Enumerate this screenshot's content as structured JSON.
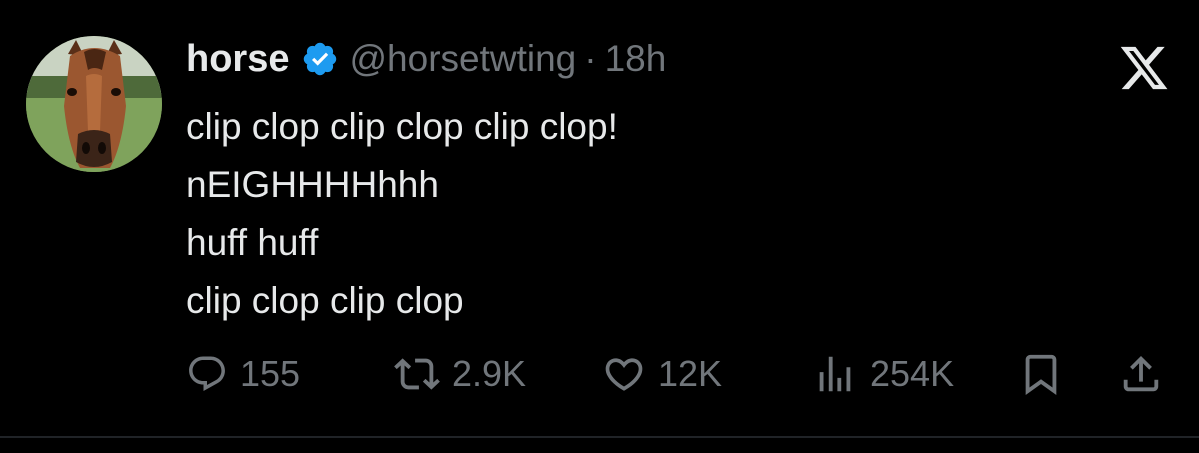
{
  "author": {
    "name": "horse",
    "handle": "@horsetwting",
    "separator": "·",
    "time": "18h",
    "verified": true,
    "avatar_icon": "horse-avatar"
  },
  "tweet": {
    "lines": [
      "clip clop clip clop clip clop!",
      "nEIGHHHHhhh",
      "huff huff",
      "clip clop clip clop"
    ]
  },
  "actions": {
    "replies": "155",
    "reposts": "2.9K",
    "likes": "12K",
    "views": "254K"
  },
  "colors": {
    "background": "#000000",
    "text": "#e7e9ea",
    "muted": "#71767b",
    "verified": "#1d9bf0"
  },
  "icons": [
    "verified-badge-icon",
    "x-logo-icon",
    "reply-icon",
    "repost-icon",
    "like-icon",
    "views-icon",
    "bookmark-icon",
    "share-icon"
  ]
}
